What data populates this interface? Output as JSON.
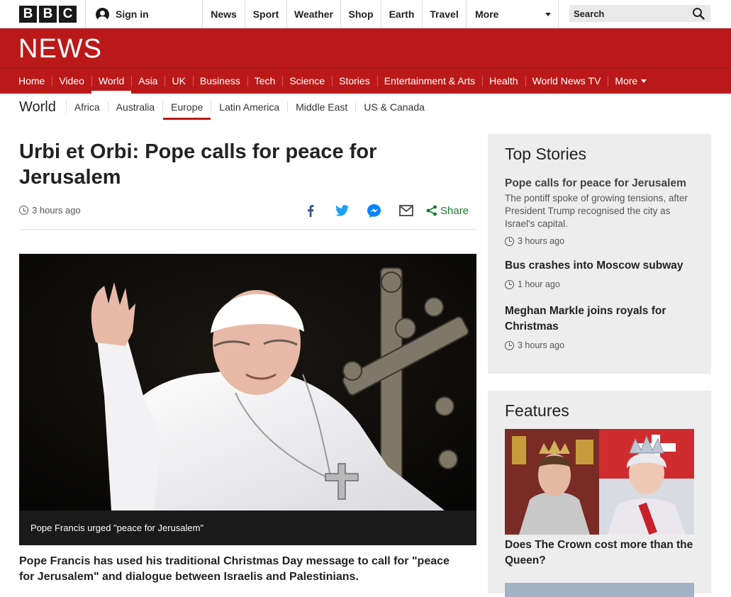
{
  "brand": {
    "letters": [
      "B",
      "B",
      "C"
    ],
    "news_logo": "NEWS"
  },
  "account": {
    "sign_in": "Sign in"
  },
  "top_nav": [
    {
      "label": "News"
    },
    {
      "label": "Sport"
    },
    {
      "label": "Weather"
    },
    {
      "label": "Shop"
    },
    {
      "label": "Earth"
    },
    {
      "label": "Travel"
    },
    {
      "label": "More"
    }
  ],
  "search": {
    "label": "Search"
  },
  "section_nav": [
    {
      "label": "Home"
    },
    {
      "label": "Video"
    },
    {
      "label": "World",
      "active": true
    },
    {
      "label": "Asia"
    },
    {
      "label": "UK"
    },
    {
      "label": "Business"
    },
    {
      "label": "Tech"
    },
    {
      "label": "Science"
    },
    {
      "label": "Stories"
    },
    {
      "label": "Entertainment & Arts"
    },
    {
      "label": "Health"
    },
    {
      "label": "World News TV"
    },
    {
      "label": "More"
    }
  ],
  "sub_nav": {
    "title": "World",
    "items": [
      {
        "label": "Africa"
      },
      {
        "label": "Australia"
      },
      {
        "label": "Europe",
        "active": true
      },
      {
        "label": "Latin America"
      },
      {
        "label": "Middle East"
      },
      {
        "label": "US & Canada"
      }
    ]
  },
  "article": {
    "headline": "Urbi et Orbi: Pope calls for peace for Jerusalem",
    "timestamp": "3 hours ago",
    "share_label": "Share",
    "share_icons": [
      "facebook-icon",
      "twitter-icon",
      "messenger-icon",
      "email-icon",
      "share-icon"
    ],
    "image_caption": "Pope Francis urged \"peace for Jerusalem\"",
    "intro": "Pope Francis has used his traditional Christmas Day message to call for \"peace for Jerusalem\" and dialogue between Israelis and Palestinians."
  },
  "top_stories": {
    "heading": "Top Stories",
    "items": [
      {
        "title": "Pope calls for peace for Jerusalem",
        "summary": "The pontiff spoke of growing tensions, after President Trump recognised the city as Israel's capital.",
        "time": "3 hours ago"
      },
      {
        "title": "Bus crashes into Moscow subway",
        "time": "1 hour ago"
      },
      {
        "title": "Meghan Markle joins royals for Christmas",
        "time": "3 hours ago"
      }
    ]
  },
  "features": {
    "heading": "Features",
    "items": [
      {
        "title": "Does The Crown cost more than the Queen?"
      }
    ]
  },
  "colors": {
    "brand_red": "#bb1919",
    "share_green": "#1e7d32",
    "sidebar_bg": "#ededed"
  }
}
